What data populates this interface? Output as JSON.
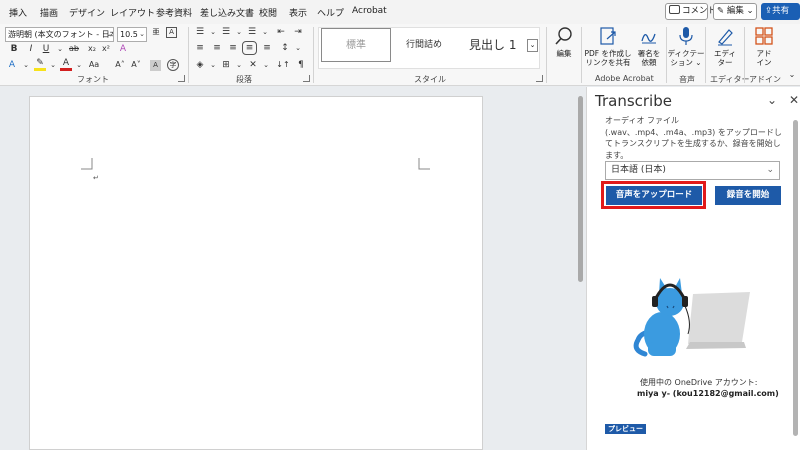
{
  "tabs": [
    "挿入",
    "描画",
    "デザイン",
    "レイアウト",
    "参考資料",
    "差し込み文書",
    "校閲",
    "表示",
    "ヘルプ",
    "Acrobat"
  ],
  "top_actions": {
    "comment": "コメント",
    "edit": "編集",
    "share": "共有"
  },
  "ribbon": {
    "font_name": "游明朝 (本文のフォント - 日本語",
    "font_size": "10.5",
    "font_group": "フォント",
    "paragraph_group": "段落",
    "styles_group": "スタイル",
    "styles": [
      "標準",
      "行間詰め",
      "見出し 1"
    ],
    "edit_label": "編集",
    "pdf_label": "PDF を作成し",
    "pdf_label2": "リンクを共有",
    "sign_label": "署名を",
    "sign_label2": "依頼",
    "adobe_group": "Adobe Acrobat",
    "dictate_label": "ディクテー",
    "dictate_label2": "ション",
    "voice_group": "音声",
    "editor_label": "エディ",
    "editor_label2": "ター",
    "editor_group": "エディター",
    "addin_label": "アド",
    "addin_label2": "イン",
    "addin_group": "アドイン"
  },
  "document": {
    "paragraph_mark": "↵"
  },
  "pane": {
    "title": "Transcribe",
    "description": "オーディオ ファイル (.wav、.mp4、.m4a、.mp3) をアップロードしてトランスクリプトを生成するか、録音を開始します。",
    "language": "日本語 (日本)",
    "upload_button": "音声をアップロード",
    "record_button": "録音を開始",
    "account_label": "使用中の OneDrive アカウント:",
    "account_value": "miya y- (kou12182@gmail.com)",
    "preview_badge": "プレビュー"
  },
  "colors": {
    "accent": "#1e5aa8",
    "highlight": "#e11a1a",
    "cat": "#3b9be0"
  }
}
